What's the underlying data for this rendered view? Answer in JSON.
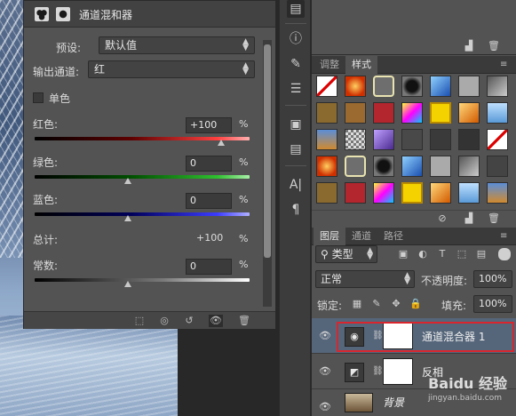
{
  "properties_panel": {
    "title": "通道混和器",
    "preset_label": "预设:",
    "preset_value": "默认值",
    "output_channel_label": "输出通道:",
    "output_channel_value": "红",
    "monochrome_label": "单色",
    "red_label": "红色:",
    "red_value": "+100",
    "red_level": 1.0,
    "green_label": "绿色:",
    "green_value": "0",
    "green_level": 0.5,
    "blue_label": "蓝色:",
    "blue_value": "0",
    "blue_level": 0.5,
    "total_label": "总计:",
    "total_value": "+100",
    "constant_label": "常数:",
    "constant_value": "0",
    "constant_level": 0.5,
    "percent": "%"
  },
  "styles_panel": {
    "tabs": [
      "调整",
      "样式"
    ],
    "active_tab": "样式"
  },
  "layers_panel": {
    "tabs": [
      "图层",
      "通道",
      "路径"
    ],
    "active_tab": "图层",
    "kind_filter": "类型",
    "blend_mode": "正常",
    "opacity_label": "不透明度:",
    "opacity_value": "100%",
    "lock_label": "锁定:",
    "fill_label": "填充:",
    "fill_value": "100%",
    "layers": [
      {
        "name": "通道混合器 1",
        "type": "adjustment",
        "selected": true
      },
      {
        "name": "反相",
        "type": "adjustment",
        "selected": false
      },
      {
        "name": "背景",
        "type": "image",
        "selected": false
      }
    ]
  },
  "watermark": {
    "brand": "Baidu 经验",
    "url": "jingyan.baidu.com"
  },
  "colors": {
    "panel_bg": "#535353",
    "selected_layer": "#55657a",
    "highlight": "#d9262e"
  }
}
